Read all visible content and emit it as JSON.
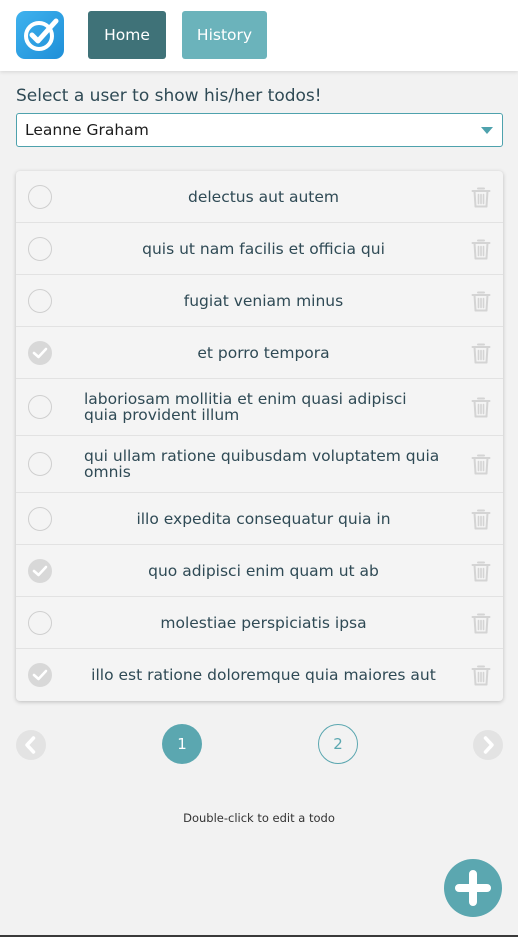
{
  "header": {
    "nav": [
      {
        "label": "Home",
        "active": true
      },
      {
        "label": "History",
        "active": false
      }
    ]
  },
  "user_picker": {
    "label": "Select a user to show his/her todos!",
    "selected": "Leanne Graham"
  },
  "todos": [
    {
      "title": "delectus aut autem",
      "completed": false
    },
    {
      "title": "quis ut nam facilis et officia qui",
      "completed": false
    },
    {
      "title": "fugiat veniam minus",
      "completed": false
    },
    {
      "title": "et porro tempora",
      "completed": true
    },
    {
      "title": "laboriosam mollitia et enim quasi adipisci quia provident illum",
      "completed": false
    },
    {
      "title": "qui ullam ratione quibusdam voluptatem quia omnis",
      "completed": false
    },
    {
      "title": "illo expedita consequatur quia in",
      "completed": false
    },
    {
      "title": "quo adipisci enim quam ut ab",
      "completed": true
    },
    {
      "title": "molestiae perspiciatis ipsa",
      "completed": false
    },
    {
      "title": "illo est ratione doloremque quia maiores aut",
      "completed": true
    }
  ],
  "pagination": {
    "pages": [
      "1",
      "2"
    ],
    "current": "1"
  },
  "hint": "Double-click to edit a todo",
  "colors": {
    "accent": "#5ba7b0",
    "nav_active": "#3f7278",
    "nav_inactive": "#6bb3bb"
  },
  "icons": {
    "logo": "checkmark-logo-icon",
    "todo_check": "circle-check-icon",
    "delete": "trash-icon",
    "prev": "chevron-left-icon",
    "next": "chevron-right-icon",
    "add": "plus-icon"
  }
}
